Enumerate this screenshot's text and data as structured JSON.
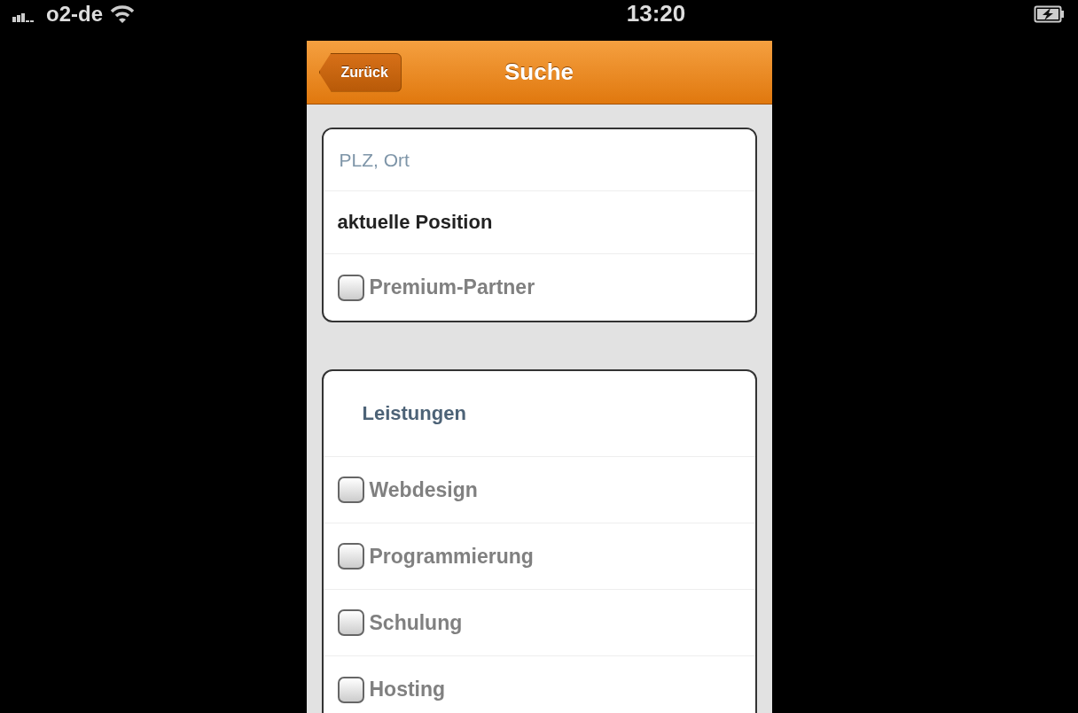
{
  "status_bar": {
    "carrier": "o2-de",
    "time": "13:20"
  },
  "nav_bar": {
    "back_button": "Zurück",
    "title": "Suche"
  },
  "location": {
    "search": {
      "placeholder": "PLZ, Ort"
    },
    "current_position": "aktuelle Position",
    "premium_partner": {
      "label": "Premium-Partner",
      "checked": false
    }
  },
  "services": {
    "heading": "Leistungen",
    "options": [
      {
        "label": "Webdesign",
        "checked": false
      },
      {
        "label": "Programmierung",
        "checked": false
      },
      {
        "label": "Schulung",
        "checked": false
      },
      {
        "label": "Hosting",
        "checked": false
      }
    ]
  }
}
